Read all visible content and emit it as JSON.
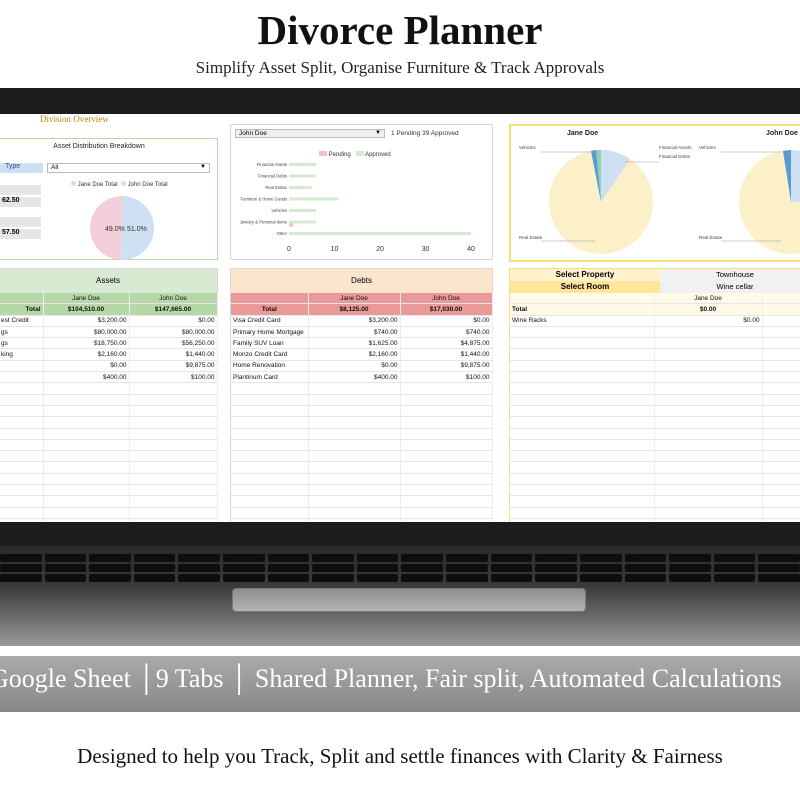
{
  "header": {
    "title": "Divorce Planner",
    "subtitle": "Simplify Asset Split, Organise Furniture & Track Approvals"
  },
  "overview": {
    "label": "Division Overview",
    "breakdown_title": "Asset Distribution Breakdown",
    "type_label": "Type",
    "type_value": "All",
    "stat1": "62.50",
    "stat2": "57.50",
    "legend": [
      "Jane Doe Total",
      "John Doe Total"
    ],
    "pie_values_pct": [
      49.0,
      51.0
    ],
    "pie_labels": [
      "49.0%",
      "51.0%"
    ],
    "colors": {
      "jane": "#f4cfd9",
      "john": "#cfe0f3"
    }
  },
  "approvals": {
    "person_select": "John Doe",
    "status_text": "1 Pending 39 Approved",
    "legend": [
      "Pending",
      "Approved"
    ],
    "categories": [
      "Financial Assets",
      "Financial Debts",
      "Real Estate",
      "Furniture & Home Goods",
      "Vehicles",
      "Jewelry & Personal Items",
      "Other"
    ],
    "pending": [
      0,
      0,
      0,
      0,
      0,
      1,
      0
    ],
    "approved": [
      6,
      6,
      5,
      11,
      6,
      6,
      40
    ],
    "x_ticks": [
      "0",
      "10",
      "20",
      "30",
      "40"
    ],
    "xlim": [
      0,
      40
    ],
    "colors": {
      "pending": "#f3c0c9",
      "approved": "#d6ead2"
    }
  },
  "person_pies": {
    "names": [
      "Jane Doe",
      "John Doe"
    ],
    "jane_labels": [
      "Vehicles",
      "Financial Assets",
      "Financial Debts",
      "Real Estate"
    ],
    "john_labels": [
      "Vehicles",
      "Real Estate"
    ],
    "slice_colors": [
      "#fbf0c8",
      "#cfe0f3",
      "#a9c9e8",
      "#8fd3b5",
      "#5a9bd4"
    ]
  },
  "assets": {
    "title": "Assets",
    "col_headers": [
      "Jane Doe",
      "John Doe"
    ],
    "total_label": "Total",
    "totals": [
      "$104,510.00",
      "$147,665.00"
    ],
    "rows": [
      {
        "name": "est Credit",
        "a": "$3,200.00",
        "b": "$0.00"
      },
      {
        "name": "gs",
        "a": "$80,000.00",
        "b": "$80,000.00"
      },
      {
        "name": "gs",
        "a": "$18,750.00",
        "b": "$56,250.00"
      },
      {
        "name": "king",
        "a": "$2,160.00",
        "b": "$1,440.00"
      },
      {
        "name": "",
        "a": "$0.00",
        "b": "$9,875.00"
      },
      {
        "name": "",
        "a": "$400.00",
        "b": "$100.00"
      }
    ],
    "colors": {
      "header": "#d9ead3",
      "subheader": "#b6d7a8"
    }
  },
  "debts": {
    "title": "Debts",
    "col_headers": [
      "Jane Doe",
      "John Doe"
    ],
    "total_label": "Total",
    "totals": [
      "$8,125.00",
      "$17,030.00"
    ],
    "rows": [
      {
        "name": "Visa Credit Card",
        "a": "$3,200.00",
        "b": "$0.00"
      },
      {
        "name": "Primary Home Mortgage",
        "a": "$740.00",
        "b": "$740.00"
      },
      {
        "name": "Family SUV Loan",
        "a": "$1,625.00",
        "b": "$4,875.00"
      },
      {
        "name": "Monzo Credit Card",
        "a": "$2,160.00",
        "b": "$1,440.00"
      },
      {
        "name": "Home Renovation",
        "a": "$0.00",
        "b": "$9,875.00"
      },
      {
        "name": "Plantinum Card",
        "a": "$400.00",
        "b": "$100.00"
      }
    ],
    "colors": {
      "header": "#fce5cd",
      "subheader": "#ea9999"
    }
  },
  "furniture": {
    "select_property_label": "Select Property",
    "property_value": "Townhouse",
    "select_room_label": "Select Room",
    "room_value": "Wine cellar",
    "col_header": "Jane Doe",
    "total_label": "Total",
    "total_value": "$0.00",
    "rows": [
      {
        "name": "Wine Racks",
        "a": "$0.00"
      }
    ],
    "colors": {
      "select": "#fff2cc",
      "select_dark": "#ffe599"
    }
  },
  "feature_line": "Google Sheet │9 Tabs │ Shared Planner, Fair split, Automated Calculations",
  "tagline": "Designed to help you Track, Split and settle finances with Clarity & Fairness"
}
